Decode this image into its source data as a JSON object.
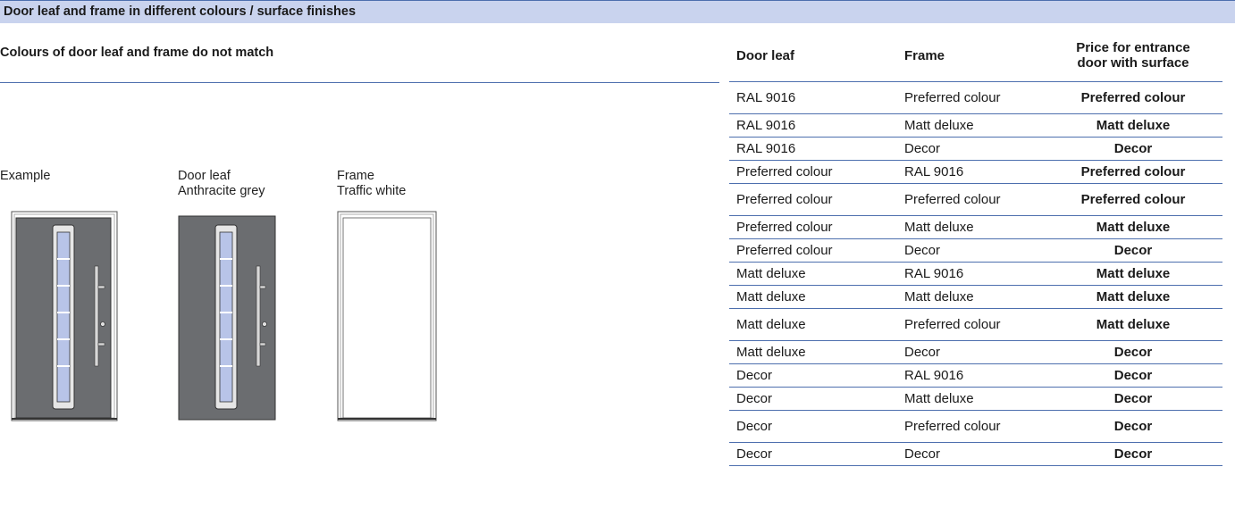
{
  "header": {
    "title": "Door leaf and frame in different colours / surface finishes"
  },
  "section": {
    "subtitle": "Colours of door leaf and frame do not match"
  },
  "examples": {
    "example": {
      "line1": "Example",
      "line2": ""
    },
    "door_leaf": {
      "line1": "Door leaf",
      "line2": "Anthracite grey"
    },
    "frame": {
      "line1": "Frame",
      "line2": "Traffic white"
    }
  },
  "colors": {
    "accent_blue": "#4d6fae",
    "banner_bg": "#c9d3ee",
    "anthracite": "#6b6d70",
    "glass": "#b8c4e8"
  },
  "table": {
    "headers": {
      "door_leaf": "Door leaf",
      "frame": "Frame",
      "price_line1": "Price for entrance",
      "price_line2": "door with surface"
    },
    "rows": [
      {
        "door_leaf": "RAL 9016",
        "frame": "Preferred colour",
        "price": "Preferred colour"
      },
      {
        "door_leaf": "RAL 9016",
        "frame": "Matt deluxe",
        "price": "Matt deluxe"
      },
      {
        "door_leaf": "RAL 9016",
        "frame": "Decor",
        "price": "Decor"
      },
      {
        "door_leaf": "Preferred colour",
        "frame": "RAL 9016",
        "price": "Preferred colour"
      },
      {
        "door_leaf": "Preferred colour",
        "frame": "Preferred colour",
        "price": "Preferred colour"
      },
      {
        "door_leaf": "Preferred colour",
        "frame": "Matt deluxe",
        "price": "Matt deluxe"
      },
      {
        "door_leaf": "Preferred colour",
        "frame": "Decor",
        "price": "Decor"
      },
      {
        "door_leaf": "Matt deluxe",
        "frame": "RAL 9016",
        "price": "Matt deluxe"
      },
      {
        "door_leaf": "Matt deluxe",
        "frame": "Matt deluxe",
        "price": "Matt deluxe"
      },
      {
        "door_leaf": "Matt deluxe",
        "frame": "Preferred colour",
        "price": "Matt deluxe"
      },
      {
        "door_leaf": "Matt deluxe",
        "frame": "Decor",
        "price": "Decor"
      },
      {
        "door_leaf": "Decor",
        "frame": "RAL 9016",
        "price": "Decor"
      },
      {
        "door_leaf": "Decor",
        "frame": "Matt deluxe",
        "price": "Decor"
      },
      {
        "door_leaf": "Decor",
        "frame": "Preferred colour",
        "price": "Decor"
      },
      {
        "door_leaf": "Decor",
        "frame": "Decor",
        "price": "Decor"
      }
    ]
  }
}
